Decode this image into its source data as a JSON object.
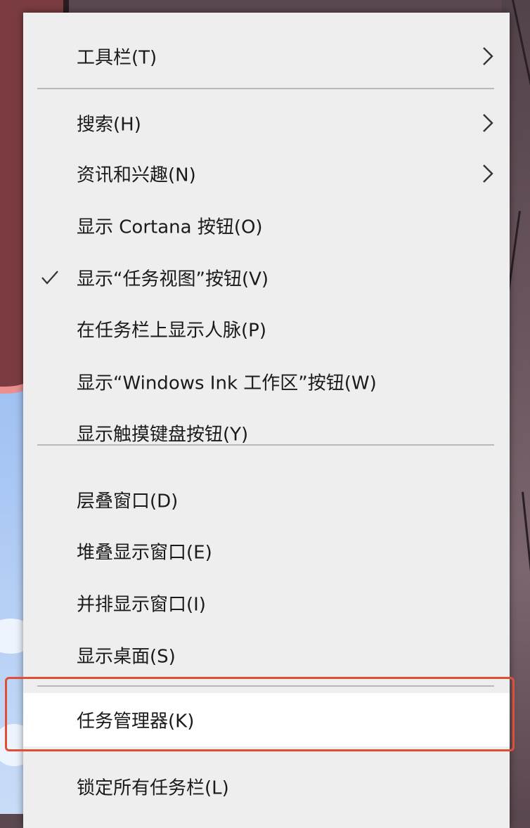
{
  "context_menu": {
    "items": [
      {
        "label": "工具栏(T)",
        "submenu": true,
        "checked": false
      },
      {
        "label": "搜索(H)",
        "submenu": true,
        "checked": false
      },
      {
        "label": "资讯和兴趣(N)",
        "submenu": true,
        "checked": false
      },
      {
        "label": "显示 Cortana 按钮(O)",
        "submenu": false,
        "checked": false
      },
      {
        "label": "显示“任务视图”按钮(V)",
        "submenu": false,
        "checked": true
      },
      {
        "label": "在任务栏上显示人脉(P)",
        "submenu": false,
        "checked": false
      },
      {
        "label": "显示“Windows Ink 工作区”按钮(W)",
        "submenu": false,
        "checked": false
      },
      {
        "label": "显示触摸键盘按钮(Y)",
        "submenu": false,
        "checked": false
      },
      {
        "label": "层叠窗口(D)",
        "submenu": false,
        "checked": false
      },
      {
        "label": "堆叠显示窗口(E)",
        "submenu": false,
        "checked": false
      },
      {
        "label": "并排显示窗口(I)",
        "submenu": false,
        "checked": false
      },
      {
        "label": "显示桌面(S)",
        "submenu": false,
        "checked": false
      },
      {
        "label": "任务管理器(K)",
        "submenu": false,
        "checked": false,
        "highlighted": true
      },
      {
        "label": "锁定所有任务栏(L)",
        "submenu": false,
        "checked": false
      }
    ],
    "highlighted_item": "任务管理器(K)"
  },
  "icons": {
    "chevron": "chevron-right-icon",
    "check": "checkmark-icon"
  },
  "colors": {
    "menu_background": "#eeeeee",
    "highlight_background": "#ffffff",
    "annotation_border": "#e04f35",
    "text": "#1a1a1a",
    "separator": "#b9b9b9"
  }
}
